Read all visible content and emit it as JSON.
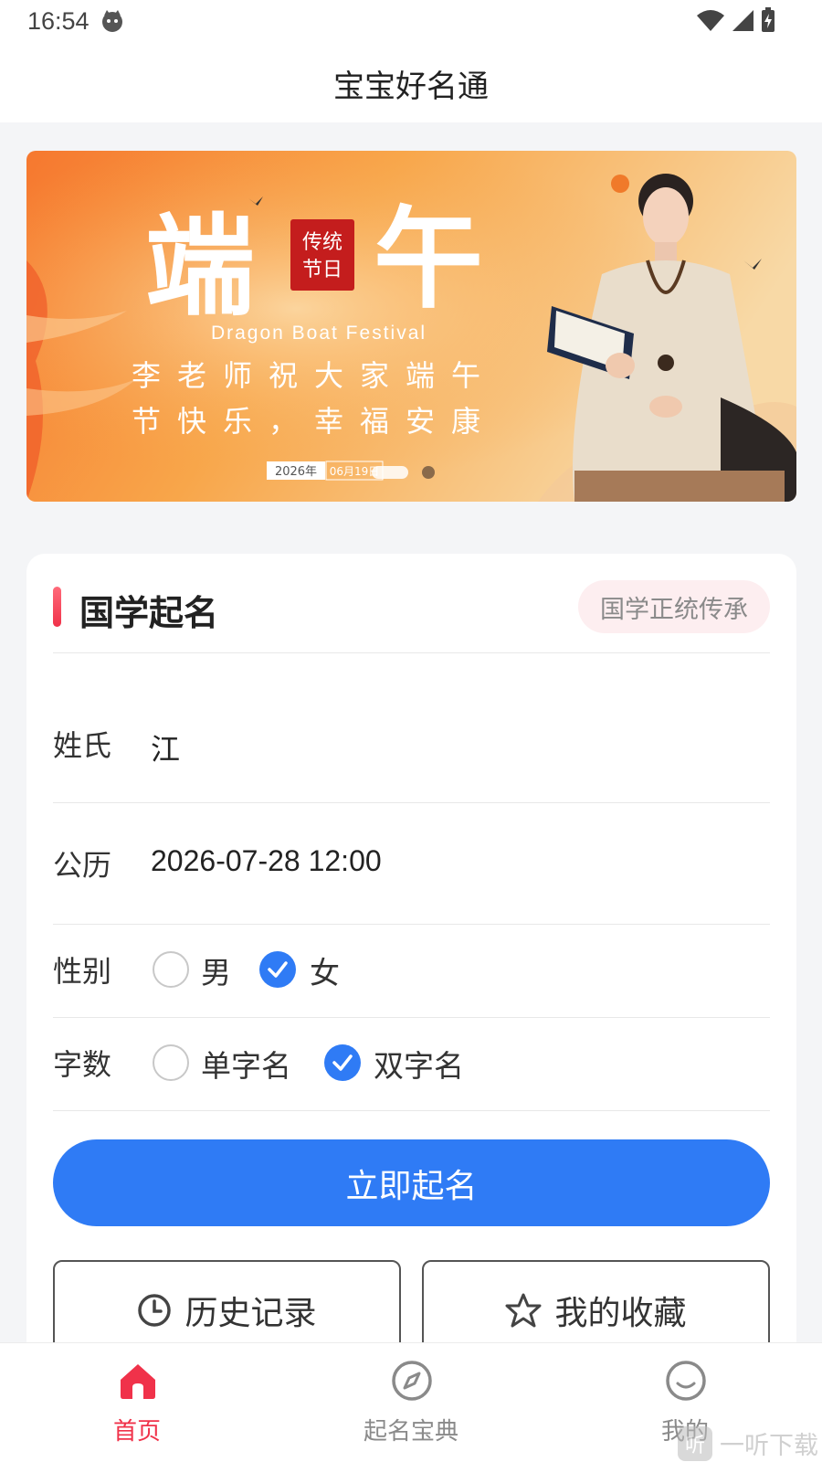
{
  "status": {
    "time": "16:54"
  },
  "app": {
    "title": "宝宝好名通"
  },
  "banner": {
    "title_left": "端",
    "title_right": "午",
    "seal_top": "传统",
    "seal_bottom": "节日",
    "subtitle_en": "Dragon Boat Festival",
    "line1": "李老师祝大家端午",
    "line2": "节快乐，幸福安康",
    "year": "2026年",
    "date": "06月19日",
    "dot_count": 2,
    "active_dot": 0
  },
  "card": {
    "title": "国学起名",
    "badge": "国学正统传承",
    "surname_label": "姓氏",
    "surname_value": "江",
    "calendar_label": "公历",
    "calendar_value": "2026-07-28 12:00",
    "gender_label": "性别",
    "gender_options": [
      "男",
      "女"
    ],
    "gender_selected": "女",
    "count_label": "字数",
    "count_options": [
      "单字名",
      "双字名"
    ],
    "count_selected": "双字名",
    "submit": "立即起名",
    "history": "历史记录",
    "favorites": "我的收藏"
  },
  "tabs": [
    {
      "label": "首页",
      "icon": "home-icon",
      "active": true
    },
    {
      "label": "起名宝典",
      "icon": "compass-icon",
      "active": false
    },
    {
      "label": "我的",
      "icon": "smiley-icon",
      "active": false
    }
  ],
  "watermark": {
    "logo": "听",
    "text": "一听下载"
  },
  "colors": {
    "primary": "#2f7bf5",
    "accent": "#f0324a"
  }
}
